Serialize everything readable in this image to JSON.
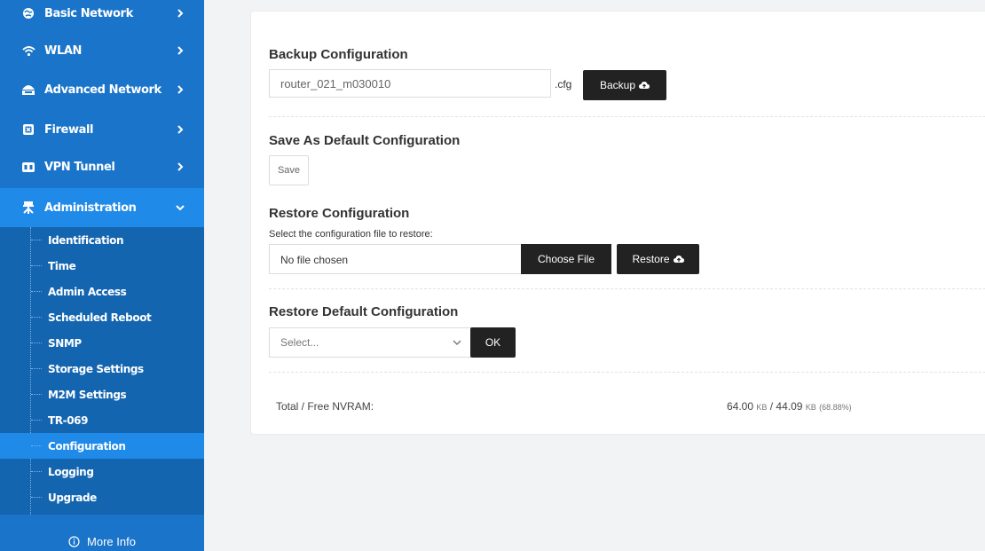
{
  "sidebar": {
    "items": [
      {
        "label": "Basic Network",
        "icon": "globe-icon"
      },
      {
        "label": "WLAN",
        "icon": "wifi-icon"
      },
      {
        "label": "Advanced Network",
        "icon": "network-icon"
      },
      {
        "label": "Firewall",
        "icon": "firewall-icon"
      },
      {
        "label": "VPN Tunnel",
        "icon": "vpn-icon"
      },
      {
        "label": "Administration",
        "icon": "admin-icon"
      }
    ],
    "sub_items": [
      {
        "label": "Identification"
      },
      {
        "label": "Time"
      },
      {
        "label": "Admin Access"
      },
      {
        "label": "Scheduled Reboot"
      },
      {
        "label": "SNMP"
      },
      {
        "label": "Storage Settings"
      },
      {
        "label": "M2M Settings"
      },
      {
        "label": "TR-069"
      },
      {
        "label": "Configuration"
      },
      {
        "label": "Logging"
      },
      {
        "label": "Upgrade"
      }
    ],
    "more_info": "More Info",
    "colors": {
      "background": "#1a74c9",
      "active": "#1f8ae8",
      "submenu": "#1465b0"
    }
  },
  "backup": {
    "title": "Backup Configuration",
    "filename": "router_021_m030010",
    "extension": ".cfg",
    "button": "Backup"
  },
  "save_default": {
    "title": "Save As Default Configuration",
    "button": "Save"
  },
  "restore": {
    "title": "Restore Configuration",
    "instruction": "Select the configuration file to restore:",
    "file_status": "No file chosen",
    "choose_button": "Choose File",
    "button": "Restore"
  },
  "restore_default": {
    "title": "Restore Default Configuration",
    "select_value": "Select...",
    "button": "OK"
  },
  "nvram": {
    "label": "Total / Free NVRAM:",
    "total": "64.00",
    "free": "44.09",
    "unit": "KB",
    "percent": "(68.88%)"
  }
}
